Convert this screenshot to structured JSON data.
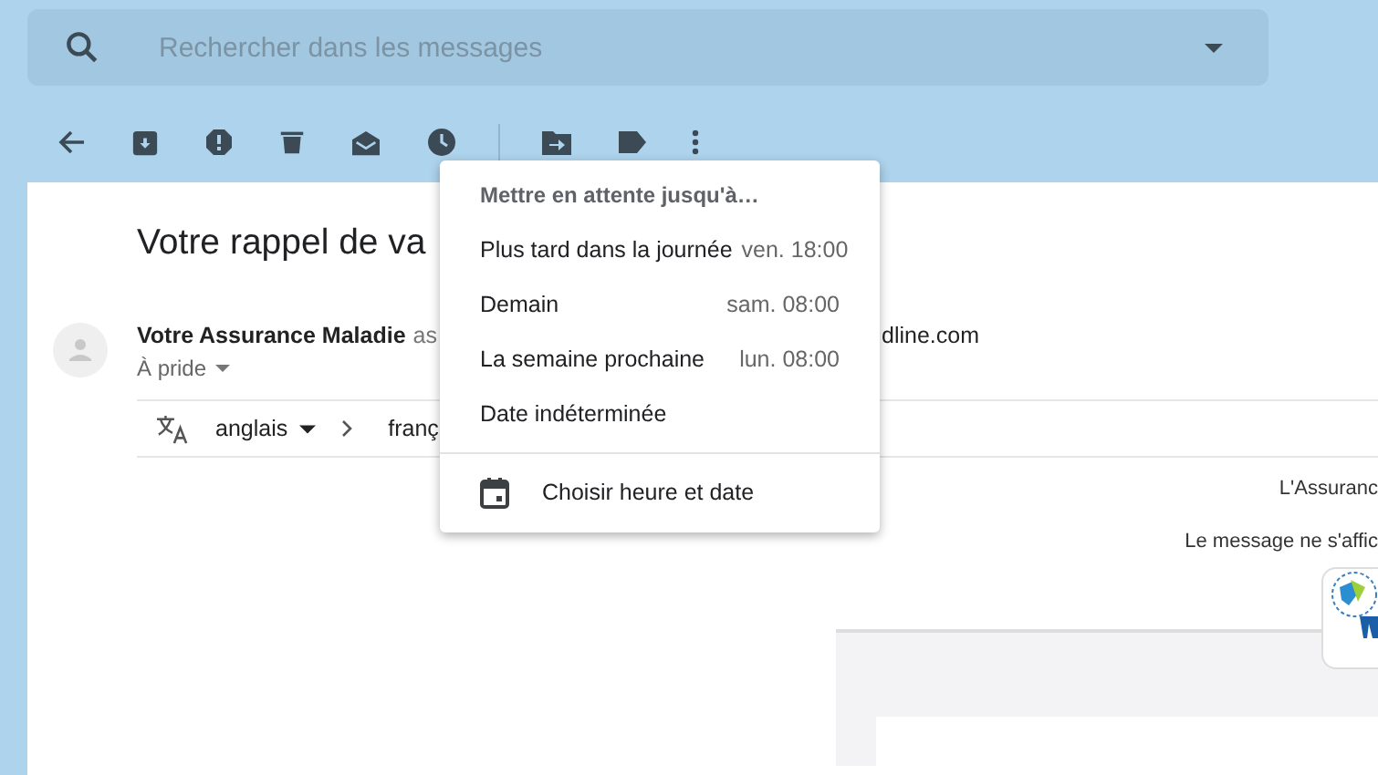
{
  "search": {
    "placeholder": "Rechercher dans les messages"
  },
  "message": {
    "subject": "Votre rappel de va",
    "sender": "Votre Assurance Maladie",
    "sender_rest": "as",
    "address_end": "dline.com",
    "recipient": "À pride"
  },
  "translate": {
    "from": "anglais",
    "to": "franç"
  },
  "body": {
    "lines": [
      "L'Assuranc",
      "Le message ne s'affic"
    ]
  },
  "snooze_menu": {
    "title": "Mettre en attente jusqu'à…",
    "options": [
      {
        "label": "Plus tard dans la journée",
        "time": "ven. 18:00"
      },
      {
        "label": "Demain",
        "time": "sam. 08:00"
      },
      {
        "label": "La semaine prochaine",
        "time": "lun. 08:00"
      },
      {
        "label": "Date indéterminée"
      }
    ],
    "custom": "Choisir heure et date"
  }
}
